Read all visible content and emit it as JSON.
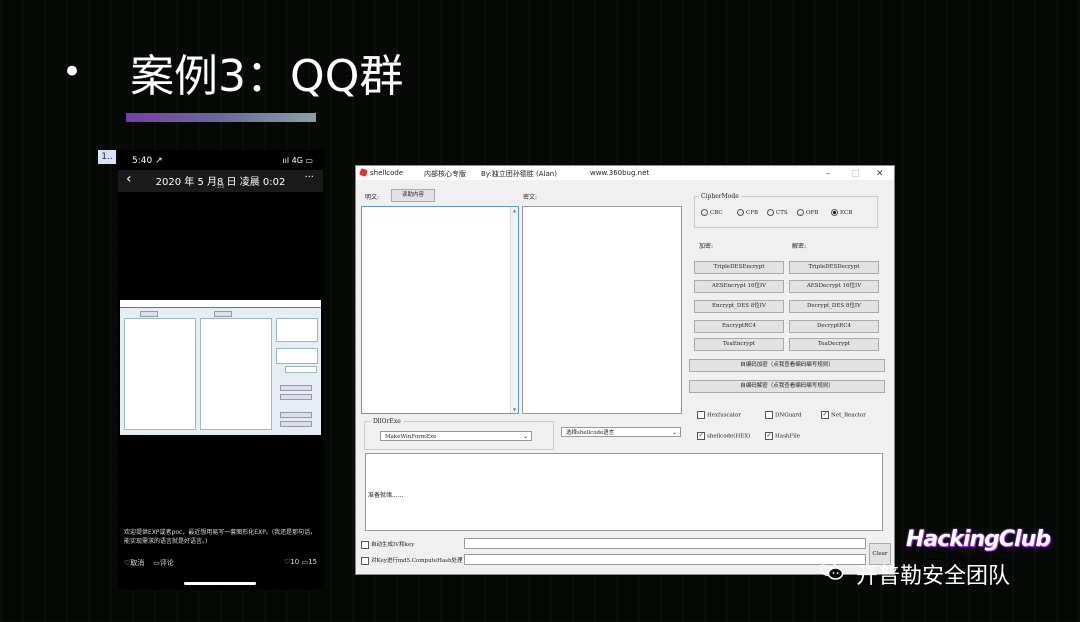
{
  "slide": {
    "bullet": "•",
    "title": "案例3：QQ群",
    "page_tag": "1.."
  },
  "phone": {
    "time": "5:40 ↗",
    "signal": "ııl 4G ▭",
    "back": "‹",
    "date": "2020 年 5 月8 日 凌晨 0:02",
    "page": "3/5",
    "more": "···",
    "caption": "欢迎提供EXP或者poc，最近想用易写一套图形化EXP。(我还是那句话，能实现需求的语言就是好语言。)",
    "cancel": "♡取消",
    "comment": "▭评论",
    "likes": "♡10",
    "comments": "▭15"
  },
  "app": {
    "title": "shellcode",
    "subtitle1": "内部核心专版",
    "subtitle2": "By:独立团孙德胜 (Alan)",
    "website": "www.360bug.net",
    "minimize": "–",
    "maximize": "□",
    "close": "✕",
    "plaintext_label": "明文:",
    "read_button": "读助内容",
    "ciphertext_label": "密文:",
    "cipher_mode": {
      "label": "CipherMode",
      "options": [
        "CBC",
        "CFB",
        "CTS",
        "OFB",
        "ECB"
      ],
      "selected": "ECB"
    },
    "encrypt_label": "加密:",
    "decrypt_label": "解密:",
    "encrypt_buttons": [
      "TripleDESEncrypt",
      "AESEncrypt 16位IV",
      "Encrypt_DES 8位IV",
      "EncryptRC4",
      "TeaEncrypt"
    ],
    "decrypt_buttons": [
      "TripleDESDecrypt",
      "AESDecrypt 16位IV",
      "Decrypt_DES 8位IV",
      "DecryptRC4",
      "TeaDecrypt"
    ],
    "self_encode_encrypt": "自编码加密（点我查看编码编写规则）",
    "self_encode_decrypt": "自编码解密（点我查看编码编写规则）",
    "checkboxes": [
      {
        "label": "Hexfuscator",
        "checked": false
      },
      {
        "label": "DNGuard",
        "checked": false
      },
      {
        "label": "Net_Reactor",
        "checked": true
      },
      {
        "label": "shellcode(HEX)",
        "checked": true
      },
      {
        "label": "HashFile",
        "checked": true
      }
    ],
    "dll_or_exe_label": "DllOrExe",
    "dll_or_exe_value": "MakeWinFormExe",
    "shellcode_lang_value": "选择shellcode语言",
    "status": "准备就绪......",
    "auto_gen_iv": "自动生成IV和key",
    "compute_hash": "对Key进行md5.ComputeHash处理",
    "clear_button": "Clear"
  },
  "watermark": {
    "logo": "HackingClub",
    "text": "开普勒安全团队"
  },
  "colors": {
    "title_bar_gradient": [
      "#7a3da8",
      "#8aa0a6"
    ],
    "focus_border": "#5a9ad8",
    "background": "#050805"
  }
}
